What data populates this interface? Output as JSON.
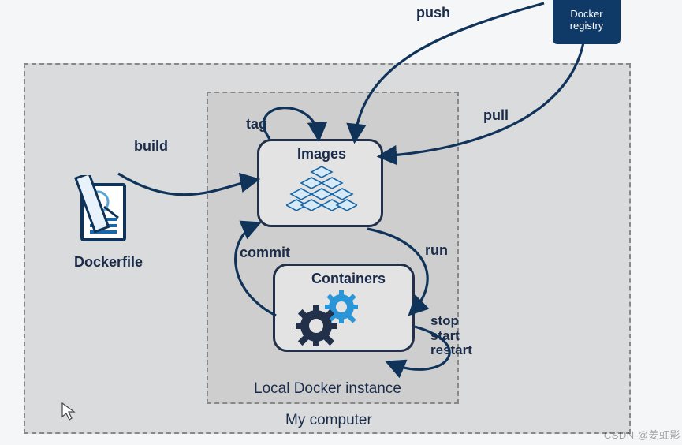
{
  "diagram": {
    "outer_label": "My computer",
    "inner_label": "Local Docker instance",
    "images_label": "Images",
    "containers_label": "Containers",
    "dockerfile_label": "Dockerfile",
    "registry_line1": "Docker",
    "registry_line2": "registry",
    "labels": {
      "push": "push",
      "pull": "pull",
      "build": "build",
      "tag": "tag",
      "commit": "commit",
      "run": "run",
      "stop": "stop",
      "start": "start",
      "restart": "restart"
    },
    "watermark": "CSDN @姜虹影"
  }
}
